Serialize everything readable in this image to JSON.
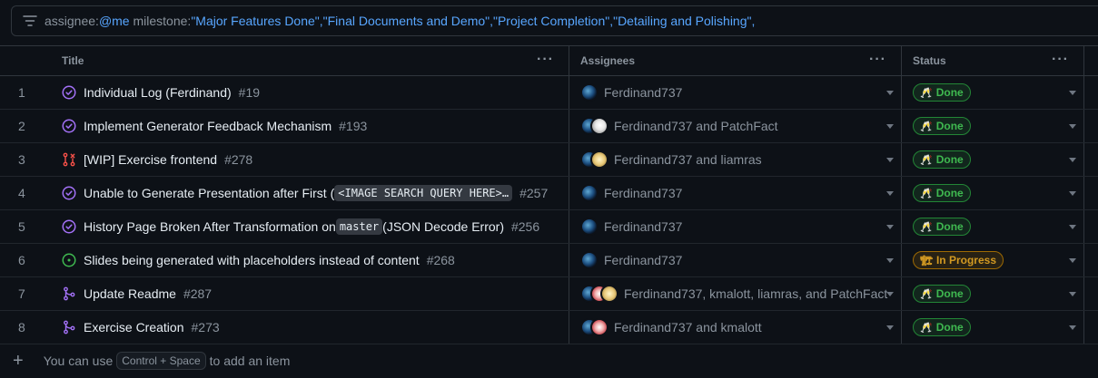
{
  "filter": {
    "assignee_key": "assignee:",
    "assignee_val": "@me",
    "milestone_key": " milestone:",
    "milestone_val": "\"Major Features Done\",\"Final Documents and Demo\",\"Project Completion\",\"Detailing and Polishing\","
  },
  "columns": {
    "title": "Title",
    "assignees": "Assignees",
    "status": "Status"
  },
  "rows": [
    {
      "num": "1",
      "icon": "issue-closed-icon",
      "title": "Individual Log (Ferdinand)",
      "code": "",
      "title_after": "",
      "number": "#19",
      "avatars": [
        "f"
      ],
      "assignees": "Ferdinand737",
      "status": "Done",
      "status_kind": "done",
      "status_emoji": "🥂"
    },
    {
      "num": "2",
      "icon": "issue-closed-icon",
      "title": "Implement Generator Feedback Mechanism",
      "code": "",
      "title_after": "",
      "number": "#193",
      "avatars": [
        "f",
        "p"
      ],
      "assignees": "Ferdinand737 and PatchFact",
      "status": "Done",
      "status_kind": "done",
      "status_emoji": "🥂"
    },
    {
      "num": "3",
      "icon": "pr-closed-icon",
      "title": "[WIP] Exercise frontend",
      "code": "",
      "title_after": "",
      "number": "#278",
      "avatars": [
        "f",
        "l"
      ],
      "assignees": "Ferdinand737 and liamras",
      "status": "Done",
      "status_kind": "done",
      "status_emoji": "🥂"
    },
    {
      "num": "4",
      "icon": "issue-closed-icon",
      "title": "Unable to Generate Presentation after First (",
      "code": "<IMAGE SEARCH QUERY HERE>…",
      "title_after": "",
      "number": "#257",
      "avatars": [
        "f"
      ],
      "assignees": "Ferdinand737",
      "status": "Done",
      "status_kind": "done",
      "status_emoji": "🥂"
    },
    {
      "num": "5",
      "icon": "issue-closed-icon",
      "title": "History Page Broken After Transformation on ",
      "code": "master",
      "title_after": " (JSON Decode Error)",
      "number": "#256",
      "avatars": [
        "f"
      ],
      "assignees": "Ferdinand737",
      "status": "Done",
      "status_kind": "done",
      "status_emoji": "🥂"
    },
    {
      "num": "6",
      "icon": "issue-open-icon",
      "title": "Slides being generated with placeholders instead of content",
      "code": "",
      "title_after": "",
      "number": "#268",
      "avatars": [
        "f"
      ],
      "assignees": "Ferdinand737",
      "status": "In Progress",
      "status_kind": "prog",
      "status_emoji": "🏗"
    },
    {
      "num": "7",
      "icon": "pr-merged-icon",
      "title": "Update Readme",
      "code": "",
      "title_after": "",
      "number": "#287",
      "avatars": [
        "f",
        "k",
        "l"
      ],
      "assignees": "Ferdinand737, kmalott, liamras, and PatchFact",
      "status": "Done",
      "status_kind": "done",
      "status_emoji": "🥂"
    },
    {
      "num": "8",
      "icon": "pr-merged-icon",
      "title": "Exercise Creation",
      "code": "",
      "title_after": "",
      "number": "#273",
      "avatars": [
        "f",
        "k"
      ],
      "assignees": "Ferdinand737 and kmalott",
      "status": "Done",
      "status_kind": "done",
      "status_emoji": "🥂"
    }
  ],
  "footer": {
    "before": "You can use",
    "kbd": "Control + Space",
    "after": "to add an item"
  },
  "colors": {
    "done": "#3fb950",
    "in_progress": "#d29922",
    "closed_issue": "#a371f7",
    "open_issue": "#3fb950",
    "closed_pr": "#f85149",
    "merged_pr": "#a371f7"
  }
}
